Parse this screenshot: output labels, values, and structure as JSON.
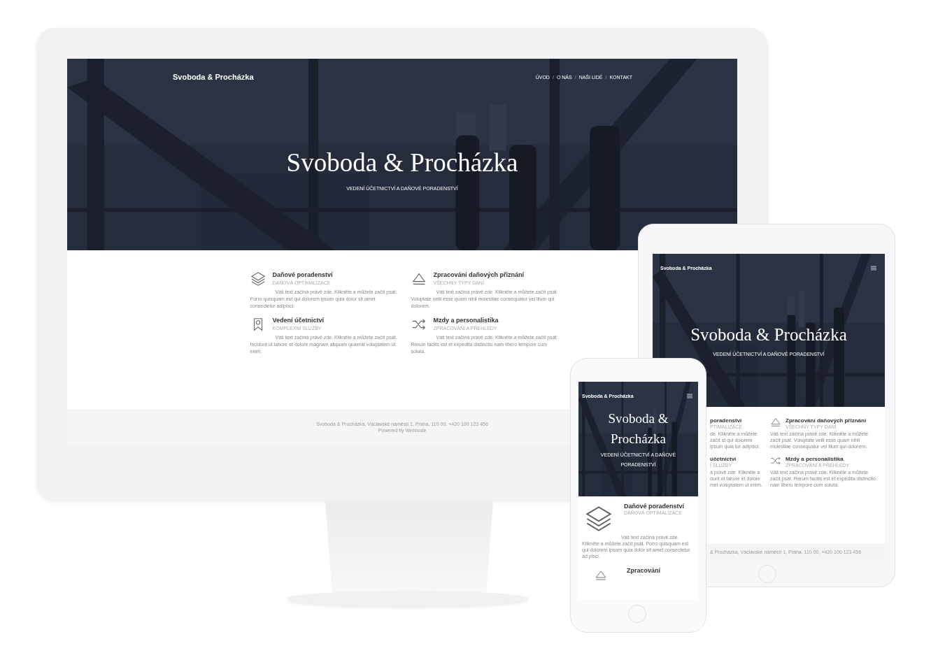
{
  "desktop": {
    "logo": "Svoboda & Procházka",
    "nav": [
      {
        "label": "ÚVOD"
      },
      {
        "label": "O NÁS"
      },
      {
        "label": "NAŠI LIDÉ"
      },
      {
        "label": "KONTAKT"
      }
    ],
    "nav_separator": "/",
    "hero": {
      "title": "Svoboda & Procházka",
      "subtitle": "VEDENÍ ÚČETNICTVÍ A DAŇOVÉ PORADENSTVÍ"
    },
    "services": [
      {
        "title": "Daňové poradenství",
        "subtitle": "DAŇOVÁ OPTIMALIZACE",
        "body": "Váš text začíná právě zde. Klikněte a můžete začít psát. Porro quisquam est qui dolorem ipsum quia dolor sit amet consectetur adipisci."
      },
      {
        "title": "Zpracování daňových přiznání",
        "subtitle": "VŠECHNY TYPY DANÍ",
        "body": "Váš text začíná právě zde. Klikněte a můžete začít psát. Voluptate velit esse quam nihil molestiae consequatur vel illum qui dolorem."
      },
      {
        "title": "Vedení účetnictví",
        "subtitle": "KOMPLEXNÍ SLUŽBY",
        "body": "Váš text začíná právě zde. Klikněte a můžete začít psát. Incidunt ut labore et dolore magnam aliquam quaerat voluptatem ut enim."
      },
      {
        "title": "Mzdy a personalistika",
        "subtitle": "ZPRACOVÁNÍ A PŘEHLEDY",
        "body": "Váš text začíná právě zde. Klikněte a můžete začít psát. Rerum facilis est et expedita distinctio nam libero tempore cum soluta."
      }
    ],
    "footer": [
      "Svoboda & Procházka, Václavské náměstí 1, Praha, 110 00, +420 100 123 456",
      "Powered by Webnode"
    ]
  },
  "tablet": {
    "logo": "Svoboda & Procházka",
    "hero": {
      "title": "Svoboda & Procházka",
      "subtitle": "VEDENÍ ÚČETNICTVÍ A DAŇOVÉ PORADENSTVÍ"
    },
    "services_left": [
      {
        "title": "poradenství",
        "subtitle": "PTIMALIZACE",
        "body": "de. Klikněte a můžete začít st qui dolorem ipsum quia tur adipisci."
      },
      {
        "title": "účetnictví",
        "subtitle": "Í SLUŽBY",
        "body": "á právě zde. Klikněte a dunt ut labore et dolore met voluptatem ut enim."
      }
    ],
    "services_right": [
      {
        "title": "Zpracování daňových přiznání",
        "subtitle": "VŠECHNY TYPY DANÍ",
        "body": "Váš text začíná právě zde. Klikněte a můžete začít psát. Voluptate velit esse quam nihil molestiae consequatur vel illum qui dolorem."
      },
      {
        "title": "Mzdy a personalistika",
        "subtitle": "ZPRACOVÁNÍ A PŘEHLEDY",
        "body": "Váš text začíná právě zde. Klikněte a můžete začít psát. Rerum facilis est et expedita distinctio nam libero tempore cum soluta."
      }
    ],
    "footer": "& Procházka, Václavské náměstí 1, Praha, 110 00, +420 100 123 456"
  },
  "phone": {
    "logo": "Svoboda & Procházka",
    "hero": {
      "title": "Svoboda & Procházka",
      "subtitle": "VEDENÍ ÚČETNICTVÍ A DAŇOVÉ PORADENSTVÍ"
    },
    "services": [
      {
        "title": "Daňové poradenství",
        "subtitle": "DAŇOVÁ OPTIMALIZACE",
        "body": "Váš text začíná právě zde. Klikněte a můžete začít psát. Porro quisquam est qui dolorem ipsum quia dolor sit amet consectetur ad pisci."
      },
      {
        "title": "Zpracování"
      }
    ]
  }
}
